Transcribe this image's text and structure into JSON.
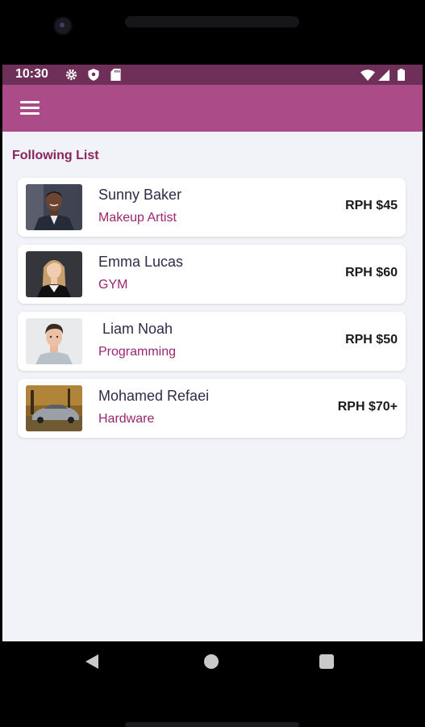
{
  "status_bar": {
    "time": "10:30",
    "icons": [
      "gear-icon",
      "shield-icon",
      "sdcard-icon",
      "wifi-icon",
      "signal-icon",
      "battery-icon"
    ]
  },
  "app_bar": {
    "menu_icon": "hamburger-menu-icon",
    "color": "#ab4b87"
  },
  "section_title": "Following List",
  "following": [
    {
      "name": "Sunny Baker",
      "role": "Makeup Artist",
      "price": "RPH $45"
    },
    {
      "name": "Emma Lucas",
      "role": "GYM",
      "price": "RPH $60"
    },
    {
      "name": " Liam Noah",
      "role": "Programming",
      "price": "RPH $50"
    },
    {
      "name": "Mohamed Refaei",
      "role": "Hardware",
      "price": "RPH $70+"
    }
  ],
  "colors": {
    "status_bar": "#6e2f58",
    "accent": "#9b2570",
    "background": "#f2f3f8"
  },
  "nav_bar": {
    "icons": [
      "back-icon",
      "home-icon",
      "recents-icon"
    ]
  }
}
